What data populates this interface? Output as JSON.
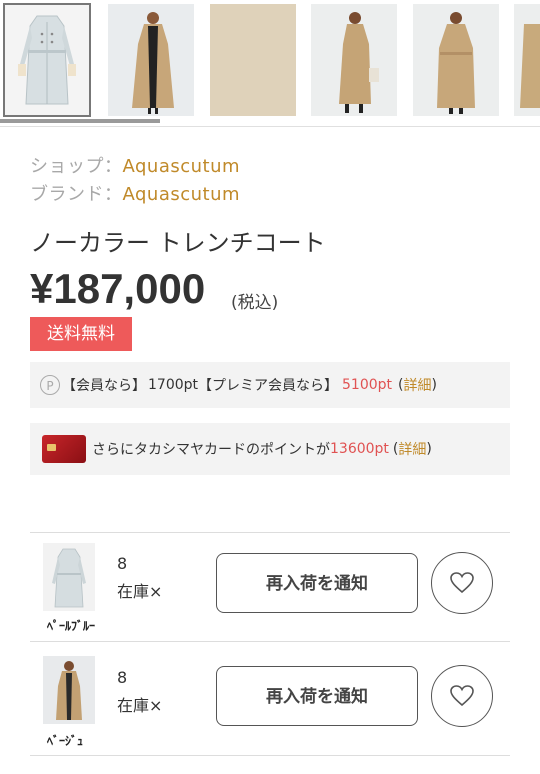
{
  "shop": {
    "label": "ショップ：",
    "value": "Aquascutum"
  },
  "brand": {
    "label": "ブランド：",
    "value": "Aquascutum"
  },
  "product": {
    "title": "ノーカラー トレンチコート"
  },
  "price": {
    "amount": "¥187,000",
    "tax_note": "(税込)"
  },
  "badge": {
    "free_shipping": "送料無料"
  },
  "points": {
    "member_label": "【会員なら】",
    "member_pts": "1700pt",
    "premium_label": "【プレミア会員なら】",
    "premium_pts": "5100pt",
    "detail_open": "(",
    "detail_link": "詳細",
    "detail_close": ")"
  },
  "card": {
    "text": "さらにタカシマヤカードのポイントが",
    "pts": "13600pt",
    "detail_open": "(",
    "detail_link": "詳細",
    "detail_close": ")"
  },
  "variants": [
    {
      "color": "ﾍﾟｰﾙﾌﾞﾙｰ",
      "size": "8",
      "stock": "在庫×",
      "button": "再入荷を通知"
    },
    {
      "color": "ﾍﾞｰｼﾞｭ",
      "size": "8",
      "stock": "在庫×",
      "button": "再入荷を通知"
    }
  ],
  "colors": {
    "accent_gold": "#c08a2a",
    "badge_red": "#ee5a5a",
    "points_red": "#e05252"
  }
}
